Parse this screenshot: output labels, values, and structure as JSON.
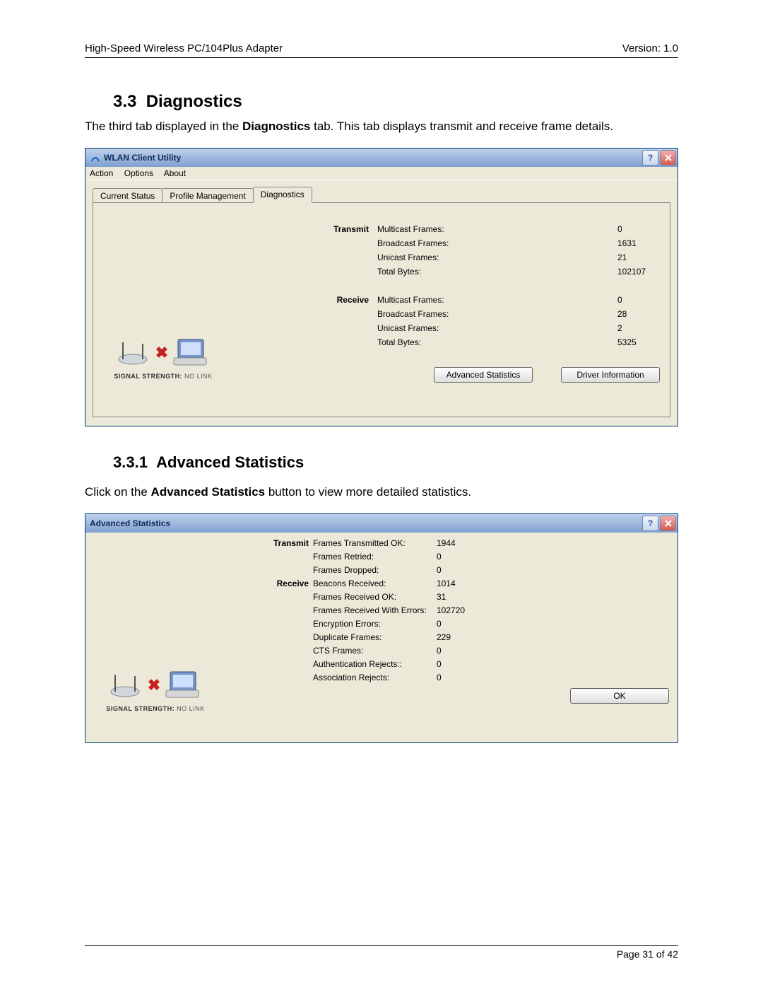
{
  "doc": {
    "header_left": "High-Speed Wireless PC/104Plus Adapter",
    "header_right": "Version: 1.0",
    "footer": "Page 31 of 42",
    "section_no": "3.3",
    "section_title": "Diagnostics",
    "para1_a": "The third tab displayed in the ",
    "para1_bold": "Diagnostics",
    "para1_b": " tab.  This tab displays transmit and receive frame details.",
    "subsection_no": "3.3.1",
    "subsection_title": "Advanced Statistics",
    "para2_a": "Click on the ",
    "para2_bold": "Advanced Statistics",
    "para2_b": " button to view more detailed statistics."
  },
  "win1": {
    "title": "WLAN Client Utility",
    "menu": {
      "action": "Action",
      "options": "Options",
      "about": "About"
    },
    "tabs": {
      "t0": "Current Status",
      "t1": "Profile Management",
      "t2": "Diagnostics"
    },
    "transmit_hdr": "Transmit",
    "receive_hdr": "Receive",
    "rows": {
      "tx_multicast_l": "Multicast Frames:",
      "tx_multicast_v": "0",
      "tx_broadcast_l": "Broadcast Frames:",
      "tx_broadcast_v": "1631",
      "tx_unicast_l": "Unicast Frames:",
      "tx_unicast_v": "21",
      "tx_total_l": "Total Bytes:",
      "tx_total_v": "102107",
      "rx_multicast_l": "Multicast Frames:",
      "rx_multicast_v": "0",
      "rx_broadcast_l": "Broadcast Frames:",
      "rx_broadcast_v": "28",
      "rx_unicast_l": "Unicast Frames:",
      "rx_unicast_v": "2",
      "rx_total_l": "Total Bytes:",
      "rx_total_v": "5325"
    },
    "signal_label": "SIGNAL STRENGTH:",
    "signal_value": "NO LINK",
    "btn_advstats": "Advanced Statistics",
    "btn_driver": "Driver Information"
  },
  "win2": {
    "title": "Advanced Statistics",
    "transmit_hdr": "Transmit",
    "receive_hdr": "Receive",
    "rows": {
      "tx_ok_l": "Frames Transmitted OK:",
      "tx_ok_v": "1944",
      "tx_retried_l": "Frames Retried:",
      "tx_retried_v": "0",
      "tx_dropped_l": "Frames Dropped:",
      "tx_dropped_v": "0",
      "rx_beacons_l": "Beacons Received:",
      "rx_beacons_v": "1014",
      "rx_ok_l": "Frames Received OK:",
      "rx_ok_v": "31",
      "rx_err_l": "Frames Received With Errors:",
      "rx_err_v": "102720",
      "enc_err_l": "Encryption Errors:",
      "enc_err_v": "0",
      "dup_l": "Duplicate Frames:",
      "dup_v": "229",
      "cts_l": "CTS Frames:",
      "cts_v": "0",
      "auth_rej_l": "Authentication Rejects::",
      "auth_rej_v": "0",
      "assoc_rej_l": "Association Rejects:",
      "assoc_rej_v": "0"
    },
    "signal_label": "SIGNAL STRENGTH:",
    "signal_value": "NO LINK",
    "btn_ok": "OK"
  }
}
